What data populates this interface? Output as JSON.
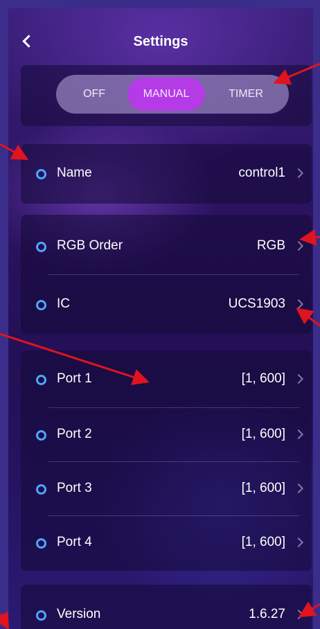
{
  "header": {
    "back_icon": "chevron-left-icon",
    "title": "Settings"
  },
  "mode": {
    "options": [
      "OFF",
      "MANUAL",
      "TIMER"
    ],
    "selected": "MANUAL"
  },
  "name_row": {
    "label": "Name",
    "value": "control1"
  },
  "config_rows": [
    {
      "label": "RGB Order",
      "value": "RGB"
    },
    {
      "label": "IC",
      "value": "UCS1903"
    }
  ],
  "port_rows": [
    {
      "label": "Port 1",
      "value": "[1, 600]"
    },
    {
      "label": "Port 2",
      "value": "[1, 600]"
    },
    {
      "label": "Port 3",
      "value": "[1, 600]"
    },
    {
      "label": "Port 4",
      "value": "[1, 600]"
    }
  ],
  "version_row": {
    "label": "Version",
    "value": "1.6.27"
  },
  "colors": {
    "accent": "#b43be6",
    "dot": "#4da6ff",
    "annotation": "#e0141e"
  }
}
